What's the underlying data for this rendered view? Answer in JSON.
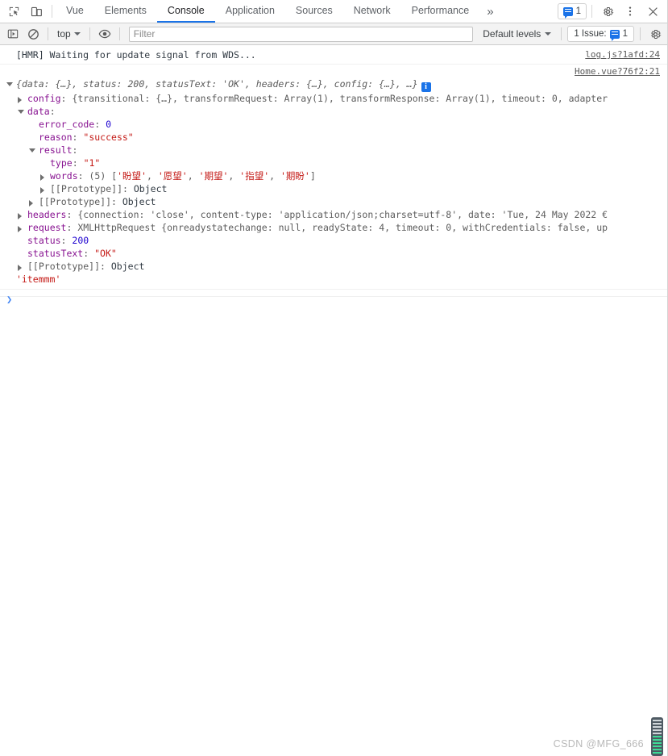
{
  "tabbar": {
    "icons": [
      {
        "name": "inspect-element-icon",
        "glyph": "inspect"
      },
      {
        "name": "device-toolbar-icon",
        "glyph": "device"
      }
    ],
    "tabs": [
      {
        "label": "Vue",
        "active": false
      },
      {
        "label": "Elements",
        "active": false
      },
      {
        "label": "Console",
        "active": true
      },
      {
        "label": "Application",
        "active": false
      },
      {
        "label": "Sources",
        "active": false
      },
      {
        "label": "Network",
        "active": false
      },
      {
        "label": "Performance",
        "active": false
      }
    ],
    "more_label": "»",
    "issues_count": "1",
    "settings_label": "Settings",
    "menu_label": "Customize and control DevTools",
    "close_label": "Close"
  },
  "toolbar": {
    "sidebar_toggle_name": "console-sidebar-toggle",
    "clear_console_name": "clear-console-icon",
    "context_value": "top",
    "eye_name": "live-expression-icon",
    "filter_placeholder": "Filter",
    "filter_value": "",
    "levels_label": "Default levels",
    "issue_label": "1 Issue:",
    "issue_count": "1",
    "settings_name": "console-settings-icon"
  },
  "console": {
    "messages": [
      {
        "type": "log",
        "text": "[HMR] Waiting for update signal from WDS...",
        "source": "log.js?1afd:24"
      },
      {
        "type": "object",
        "source": "Home.vue?76f2:21",
        "preview": {
          "open_brace": "{",
          "parts": "data: {…}, status: 200, statusText: 'OK', headers: {…}, config: {…}, …",
          "close_brace": "}",
          "info_badge": "i"
        },
        "rows": [
          {
            "indent": 1,
            "tri": "closed",
            "key": "config",
            "sep": ": ",
            "value": "{transitional: {…}, transformRequest: Array(1), transformResponse: Array(1), timeout: 0, adapter"
          },
          {
            "indent": 1,
            "tri": "open",
            "key": "data",
            "sep": ":",
            "value": ""
          },
          {
            "indent": 2,
            "tri": "none",
            "key": "error_code",
            "sep": ": ",
            "value": "0",
            "vtype": "num"
          },
          {
            "indent": 2,
            "tri": "none",
            "key": "reason",
            "sep": ": ",
            "value": "\"success\"",
            "vtype": "str"
          },
          {
            "indent": 2,
            "tri": "open",
            "key": "result",
            "sep": ":",
            "value": ""
          },
          {
            "indent": 3,
            "tri": "none",
            "key": "type",
            "sep": ": ",
            "value": "\"1\"",
            "vtype": "str"
          },
          {
            "indent": 3,
            "tri": "closed",
            "key": "words",
            "sep": ": ",
            "count": "(5)",
            "array": [
              "'盼望'",
              "'愿望'",
              "'期望'",
              "'指望'",
              "'期盼'"
            ]
          },
          {
            "indent": 3,
            "tri": "closed",
            "key": "[[Prototype]]",
            "sep": ": ",
            "value": "Object",
            "vtype": "obj"
          },
          {
            "indent": 2,
            "tri": "closed",
            "key": "[[Prototype]]",
            "sep": ": ",
            "value": "Object",
            "vtype": "obj"
          },
          {
            "indent": 1,
            "tri": "closed",
            "key": "headers",
            "sep": ": ",
            "value": "{connection: 'close', content-type: 'application/json;charset=utf-8', date: 'Tue, 24 May 2022 €"
          },
          {
            "indent": 1,
            "tri": "closed",
            "key": "request",
            "sep": ": ",
            "value": "XMLHttpRequest {onreadystatechange: null, readyState: 4, timeout: 0, withCredentials: false, uр"
          },
          {
            "indent": 1,
            "tri": "none",
            "key": "status",
            "sep": ": ",
            "value": "200",
            "vtype": "num"
          },
          {
            "indent": 1,
            "tri": "none",
            "key": "statusText",
            "sep": ": ",
            "value": "\"OK\"",
            "vtype": "str"
          },
          {
            "indent": 1,
            "tri": "closed",
            "key": "[[Prototype]]",
            "sep": ": ",
            "value": "Object",
            "vtype": "obj"
          }
        ]
      },
      {
        "type": "string",
        "text": "'itemmm'"
      }
    ],
    "prompt_caret": "❯"
  },
  "watermark": {
    "text": "CSDN @MFG_666"
  },
  "colors": {
    "accent": "#1a73e8",
    "property": "#881391",
    "string": "#c41a16",
    "number": "#1c00cf",
    "keyword": "#0d22aa",
    "gray": "#5c5c5c"
  }
}
